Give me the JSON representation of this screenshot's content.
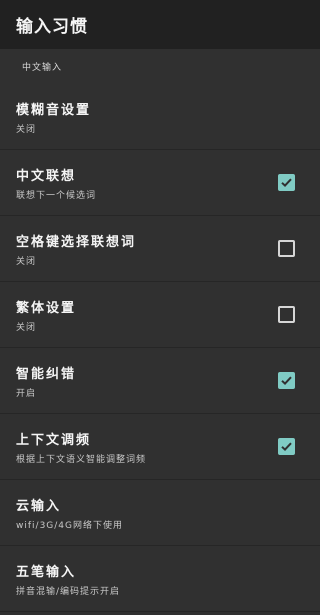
{
  "toolbar": {
    "title": "输入习惯"
  },
  "section": {
    "header": "中文输入"
  },
  "preferences": [
    {
      "title": "模糊音设置",
      "summary": "关闭",
      "checkbox": null
    },
    {
      "title": "中文联想",
      "summary": "联想下一个候选词",
      "checkbox": true
    },
    {
      "title": "空格键选择联想词",
      "summary": "关闭",
      "checkbox": false
    },
    {
      "title": "繁体设置",
      "summary": "关闭",
      "checkbox": false
    },
    {
      "title": "智能纠错",
      "summary": "开启",
      "checkbox": true
    },
    {
      "title": "上下文调频",
      "summary": "根据上下文语义智能调整词频",
      "checkbox": true
    },
    {
      "title": "云输入",
      "summary": "wifi/3G/4G网络下使用",
      "checkbox": null
    },
    {
      "title": "五笔输入",
      "summary": "拼音混输/编码提示开启",
      "checkbox": null
    }
  ],
  "colors": {
    "accent": "#80cbc4",
    "toolbar_bg": "#212121",
    "background": "#303030"
  }
}
